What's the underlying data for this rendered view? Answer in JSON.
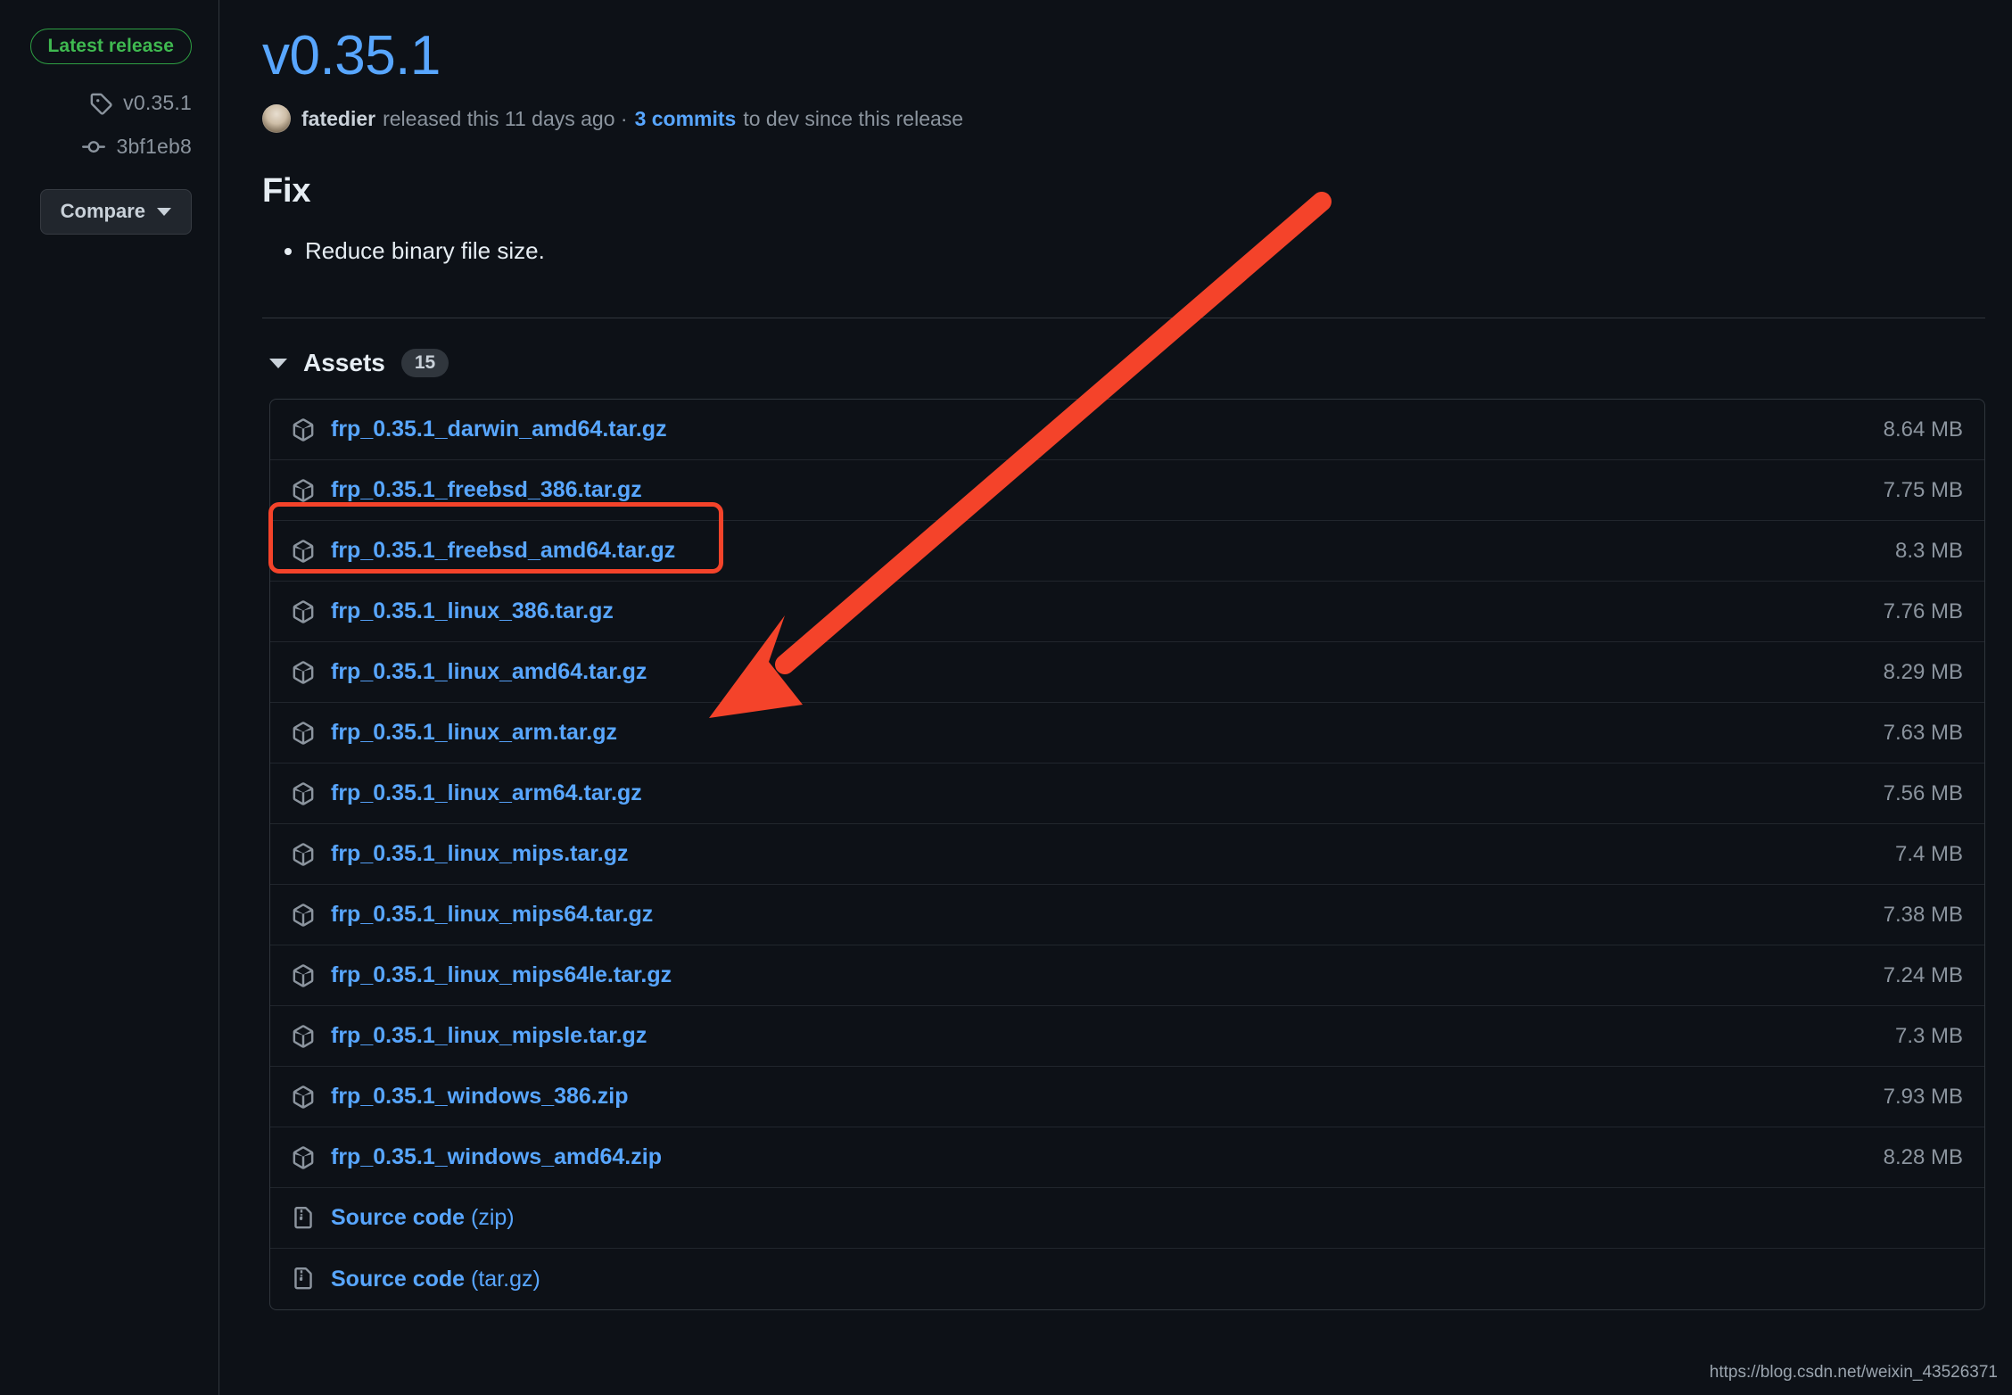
{
  "sidebar": {
    "badge_label": "Latest release",
    "tag_label": "v0.35.1",
    "commit_label": "3bf1eb8",
    "compare_label": "Compare"
  },
  "release": {
    "title": "v0.35.1",
    "author": "fatedier",
    "released_text": "released this 11 days ago ·",
    "commits_link": "3 commits",
    "commits_suffix": "to dev since this release"
  },
  "body": {
    "heading": "Fix",
    "bullets": [
      "Reduce binary file size."
    ]
  },
  "assets": {
    "title": "Assets",
    "count": "15",
    "rows": [
      {
        "name": "frp_0.35.1_darwin_amd64.tar.gz",
        "suffix": "",
        "size": "8.64 MB",
        "icon": "package-icon"
      },
      {
        "name": "frp_0.35.1_freebsd_386.tar.gz",
        "suffix": "",
        "size": "7.75 MB",
        "icon": "package-icon"
      },
      {
        "name": "frp_0.35.1_freebsd_amd64.tar.gz",
        "suffix": "",
        "size": "8.3 MB",
        "icon": "package-icon"
      },
      {
        "name": "frp_0.35.1_linux_386.tar.gz",
        "suffix": "",
        "size": "7.76 MB",
        "icon": "package-icon"
      },
      {
        "name": "frp_0.35.1_linux_amd64.tar.gz",
        "suffix": "",
        "size": "8.29 MB",
        "icon": "package-icon"
      },
      {
        "name": "frp_0.35.1_linux_arm.tar.gz",
        "suffix": "",
        "size": "7.63 MB",
        "icon": "package-icon"
      },
      {
        "name": "frp_0.35.1_linux_arm64.tar.gz",
        "suffix": "",
        "size": "7.56 MB",
        "icon": "package-icon"
      },
      {
        "name": "frp_0.35.1_linux_mips.tar.gz",
        "suffix": "",
        "size": "7.4 MB",
        "icon": "package-icon"
      },
      {
        "name": "frp_0.35.1_linux_mips64.tar.gz",
        "suffix": "",
        "size": "7.38 MB",
        "icon": "package-icon"
      },
      {
        "name": "frp_0.35.1_linux_mips64le.tar.gz",
        "suffix": "",
        "size": "7.24 MB",
        "icon": "package-icon"
      },
      {
        "name": "frp_0.35.1_linux_mipsle.tar.gz",
        "suffix": "",
        "size": "7.3 MB",
        "icon": "package-icon"
      },
      {
        "name": "frp_0.35.1_windows_386.zip",
        "suffix": "",
        "size": "7.93 MB",
        "icon": "package-icon"
      },
      {
        "name": "frp_0.35.1_windows_amd64.zip",
        "suffix": "",
        "size": "8.28 MB",
        "icon": "package-icon"
      },
      {
        "name": "Source code",
        "suffix": " (zip)",
        "size": "",
        "icon": "file-zip-icon"
      },
      {
        "name": "Source code",
        "suffix": " (tar.gz)",
        "size": "",
        "icon": "file-zip-icon"
      }
    ]
  },
  "annotation": {
    "highlight_row_index": 4,
    "highlight_color": "#f4432a",
    "arrow_color": "#f4432a"
  },
  "watermark": {
    "text": "https://blog.csdn.net/weixin_43526371"
  },
  "colors": {
    "background": "#0d1117",
    "link": "#58a6ff",
    "muted": "#8b949e",
    "border": "#30363d",
    "green": "#3fb950"
  }
}
